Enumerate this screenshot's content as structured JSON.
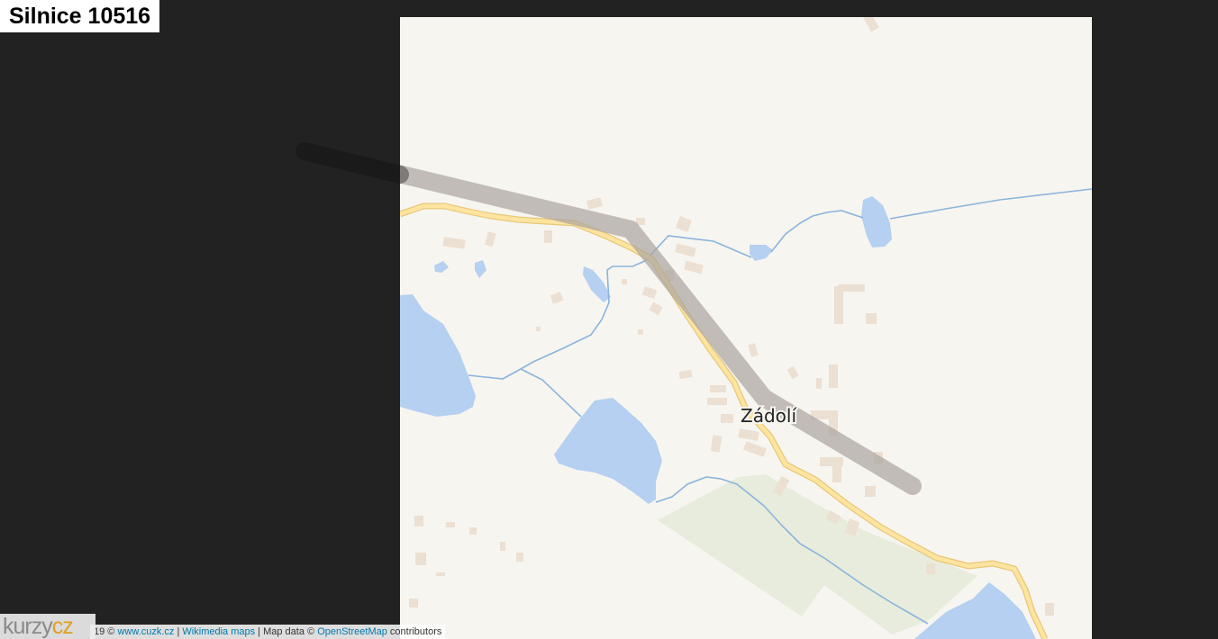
{
  "title": "Silnice 10516",
  "map": {
    "place_label": "Zádolí",
    "colors": {
      "background": "#222222",
      "land": "#f7f5f0",
      "water": "#b5d0f0",
      "stream": "#8ab4dc",
      "road_fill": "#fde4a0",
      "road_casing": "#e8c878",
      "highlight": "#b4aeaa",
      "buildings": "#ebe0d2",
      "meadow": "#e8ecdc"
    }
  },
  "attribution": {
    "prefix": "19 ©",
    "cuzk_link": "www.cuzk.cz",
    "sep1": "|",
    "wikimedia_link": "Wikimedia maps",
    "sep2": "| Map data ©",
    "osm_link": "OpenStreetMap",
    "suffix": "contributors"
  },
  "logo": {
    "part1": "kurzy",
    "part2": "cz"
  }
}
